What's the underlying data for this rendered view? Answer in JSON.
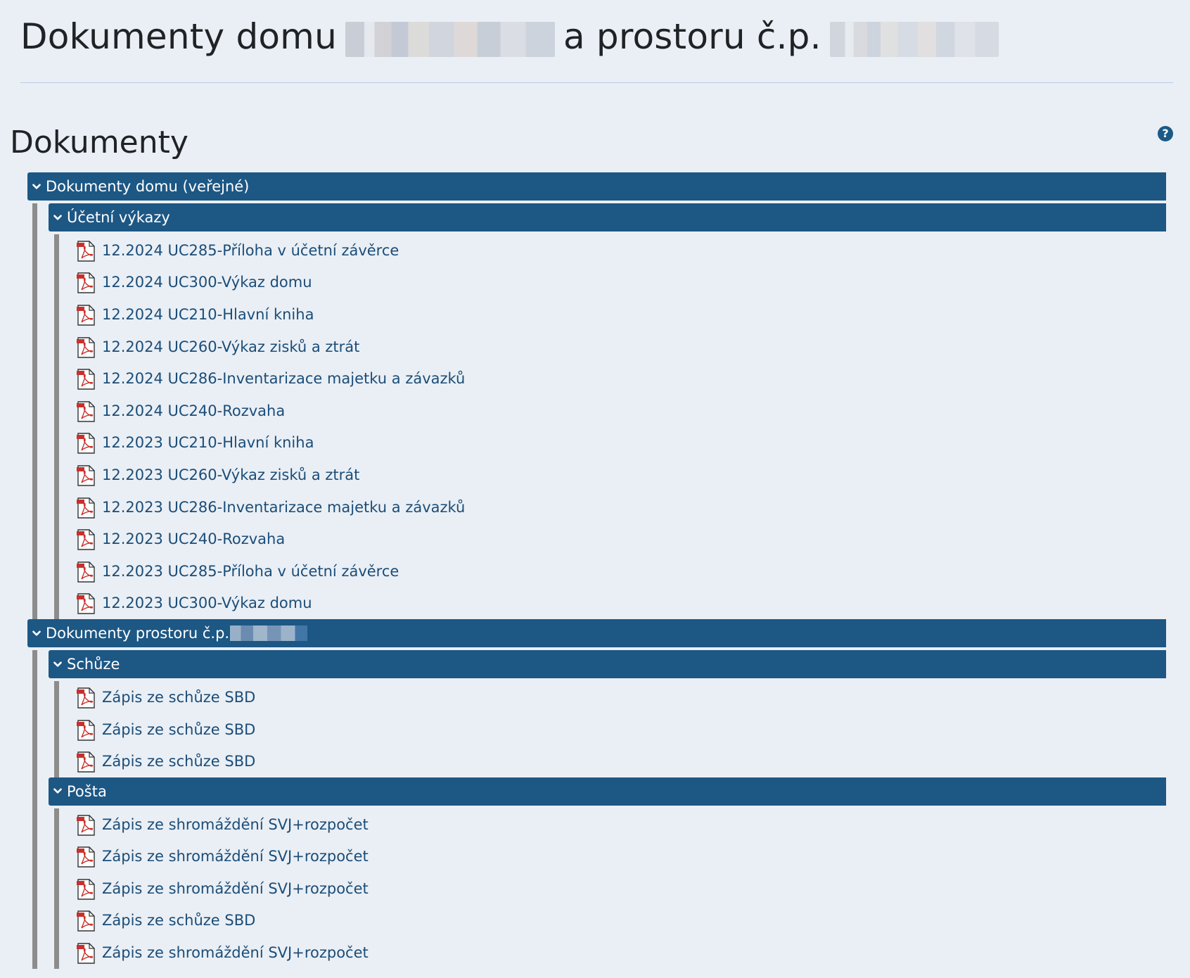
{
  "page": {
    "title_part1": "Dokumenty domu",
    "title_part2": "a prostoru č.p."
  },
  "section": {
    "heading": "Dokumenty",
    "help_glyph": "?"
  },
  "colors": {
    "folder_bar": "#1d5784",
    "link_text": "#1b4d78",
    "tree_line": "#8c8c8c",
    "background": "#eaeff5"
  },
  "tree": [
    {
      "label": "Dokumenty domu (veřejné)",
      "subfolders": [
        {
          "label": "Účetní výkazy",
          "files": [
            "12.2024 UC285-Příloha v účetní závěrce",
            "12.2024 UC300-Výkaz domu",
            "12.2024 UC210-Hlavní kniha",
            "12.2024 UC260-Výkaz zisků a ztrát",
            "12.2024 UC286-Inventarizace majetku a závazků",
            "12.2024 UC240-Rozvaha",
            "12.2023 UC210-Hlavní kniha",
            "12.2023 UC260-Výkaz zisků a ztrát",
            "12.2023 UC286-Inventarizace majetku a závazků",
            "12.2023 UC240-Rozvaha",
            "12.2023 UC285-Příloha v účetní závěrce",
            "12.2023 UC300-Výkaz domu"
          ]
        }
      ]
    },
    {
      "label": "Dokumenty prostoru č.p.",
      "subfolders": [
        {
          "label": "Schůze",
          "files": [
            "Zápis ze schůze SBD",
            "Zápis ze schůze SBD",
            "Zápis ze schůze SBD"
          ]
        },
        {
          "label": "Pošta",
          "files": [
            "Zápis ze shromáždění SVJ+rozpočet",
            "Zápis ze shromáždění SVJ+rozpočet",
            "Zápis ze shromáždění SVJ+rozpočet",
            "Zápis ze schůze SBD",
            "Zápis ze shromáždění SVJ+rozpočet"
          ]
        }
      ]
    }
  ],
  "icons": {
    "folder_toggle": "chevron-down-icon",
    "file": "pdf-file-icon",
    "help": "help-icon"
  }
}
